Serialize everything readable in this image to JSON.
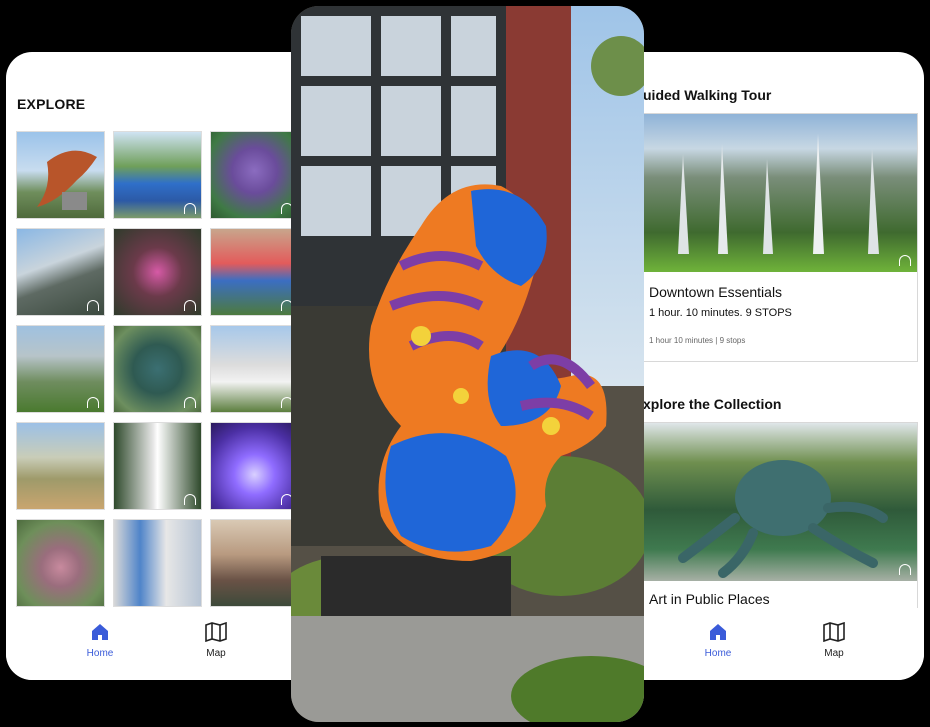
{
  "left_screen": {
    "title": "EXPLORE",
    "grid_tiles": [
      {
        "name": "tile-gramophone-sculpture",
        "has_audio": false
      },
      {
        "name": "tile-blue-mural-wall",
        "has_audio": true
      },
      {
        "name": "tile-purple-octopus-sculpture",
        "has_audio": true
      },
      {
        "name": "tile-building-facade",
        "has_audio": true
      },
      {
        "name": "tile-pink-tree-installation",
        "has_audio": true
      },
      {
        "name": "tile-colorful-sculpture-garden",
        "has_audio": true
      },
      {
        "name": "tile-silver-spikes-sculpture",
        "has_audio": true
      },
      {
        "name": "tile-green-octopus-sculpture",
        "has_audio": true
      },
      {
        "name": "tile-pineapple-sculpture",
        "has_audio": true
      },
      {
        "name": "tile-landscape-mural",
        "has_audio": false
      },
      {
        "name": "tile-white-column-sculpture",
        "has_audio": true
      },
      {
        "name": "tile-purple-light-tunnel",
        "has_audio": true
      },
      {
        "name": "tile-geodesic-sphere-sculpture",
        "has_audio": false
      },
      {
        "name": "tile-tower-mural",
        "has_audio": false
      },
      {
        "name": "tile-portrait-mural",
        "has_audio": false
      }
    ],
    "nav": {
      "home_label": "Home",
      "map_label": "Map"
    }
  },
  "right_screen": {
    "section1_title": "uided Walking Tour",
    "tour_card": {
      "title": "Downtown Essentials",
      "subtitle": "1 hour. 10 minutes. 9 STOPS",
      "meta": "1 hour 10 minutes | 9 stops"
    },
    "section2_title": "xplore the Collection",
    "collection_card": {
      "title": "Art in Public Places"
    },
    "nav": {
      "home_label": "Home",
      "map_label": "Map"
    }
  },
  "colors": {
    "accent": "#3a5bd9",
    "background": "#000000"
  },
  "icons": [
    "home-icon",
    "map-icon",
    "headphones-icon"
  ]
}
